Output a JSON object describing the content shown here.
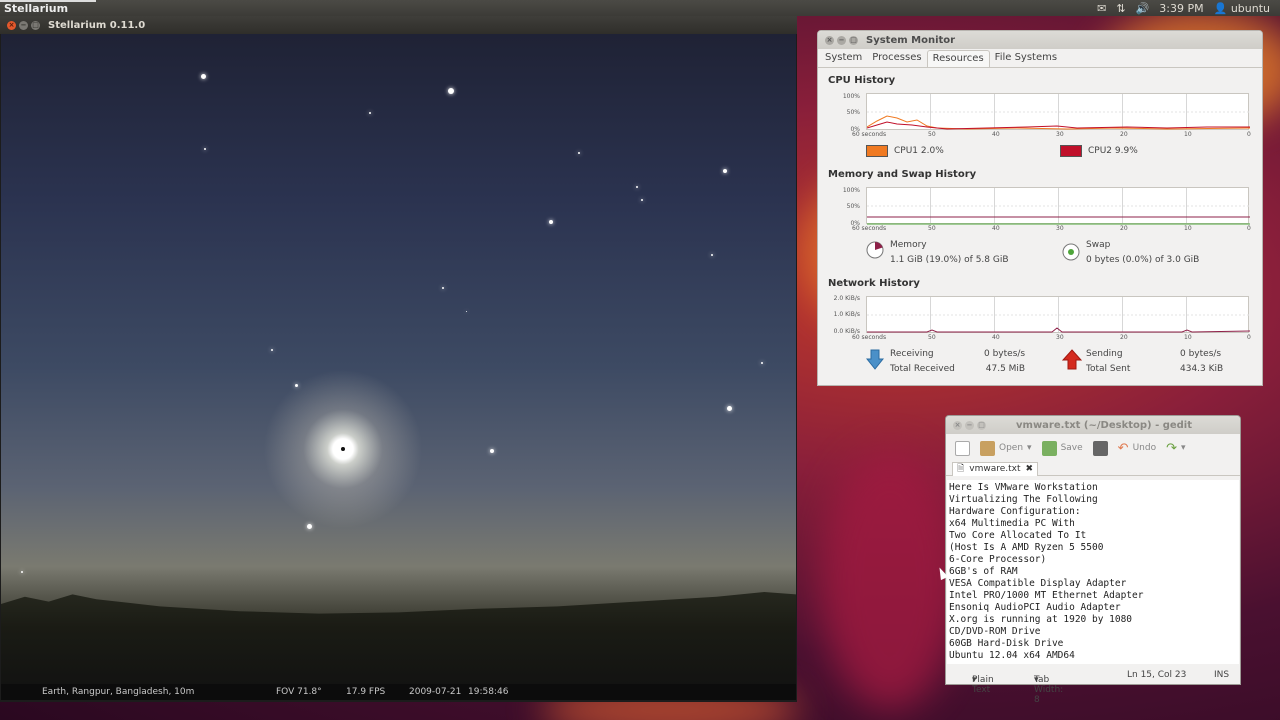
{
  "top_panel": {
    "app_name": "Stellarium",
    "clock": "3:39 PM",
    "user": "ubuntu",
    "icons": [
      "mail-icon",
      "network-icon",
      "volume-icon",
      "user-icon"
    ]
  },
  "stellarium": {
    "title": "Stellarium 0.11.0",
    "status": {
      "location": "Earth, Rangpur, Bangladesh, 10m",
      "fov": "FOV 71.8°",
      "fps": "17.9 FPS",
      "date": "2009-07-21",
      "time": "19:58:46"
    }
  },
  "system_monitor": {
    "title": "System Monitor",
    "tabs": [
      "System",
      "Processes",
      "Resources",
      "File Systems"
    ],
    "active_tab": "Resources",
    "x_ticks": [
      "60 seconds",
      "50",
      "40",
      "30",
      "20",
      "10",
      "0"
    ],
    "cpu": {
      "heading": "CPU History",
      "y_ticks": [
        "100%",
        "50%",
        "0%"
      ],
      "cpu1": {
        "label": "CPU1  2.0%",
        "color": "#f07a22"
      },
      "cpu2": {
        "label": "CPU2  9.9%",
        "color": "#c0102a"
      }
    },
    "memory": {
      "heading": "Memory and Swap History",
      "y_ticks": [
        "100%",
        "50%",
        "0%"
      ],
      "mem_label": "Memory",
      "mem_value": "1.1 GiB (19.0%) of 5.8 GiB",
      "swap_label": "Swap",
      "swap_value": "0 bytes (0.0%) of 3.0 GiB",
      "mem_color": "#8e2048",
      "swap_color": "#4ea53a"
    },
    "network": {
      "heading": "Network History",
      "y_ticks": [
        "2.0 KiB/s",
        "1.0 KiB/s",
        "0.0 KiB/s"
      ],
      "receiving_label": "Receiving",
      "receiving_rate": "0 bytes/s",
      "total_received_label": "Total Received",
      "total_received": "47.5 MiB",
      "sending_label": "Sending",
      "sending_rate": "0 bytes/s",
      "total_sent_label": "Total Sent",
      "total_sent": "434.3 KiB"
    }
  },
  "gedit": {
    "title": "vmware.txt (~/Desktop) - gedit",
    "toolbar": {
      "open": "Open",
      "save": "Save",
      "undo": "Undo"
    },
    "tab_name": "vmware.txt",
    "lines": [
      "Here Is VMware Workstation",
      "Virtualizing The Following",
      "Hardware Configuration:",
      "x64 Multimedia PC With",
      "Two Core Allocated To It",
      "(Host Is A AMD Ryzen 5 5500",
      "6-Core Processor)",
      "6GB's of RAM",
      "VESA Compatible Display Adapter",
      "Intel PRO/1000 MT Ethernet Adapter",
      "Ensoniq AudioPCI Audio Adapter",
      "X.org is running at 1920 by 1080",
      "CD/DVD-ROM Drive",
      "60GB Hard-Disk Drive",
      "Ubuntu 12.04 x64 AMD64"
    ],
    "status": {
      "syntax": "Plain Text",
      "tab_width": "Tab Width: 8",
      "position": "Ln 15, Col 23",
      "mode": "INS"
    }
  }
}
